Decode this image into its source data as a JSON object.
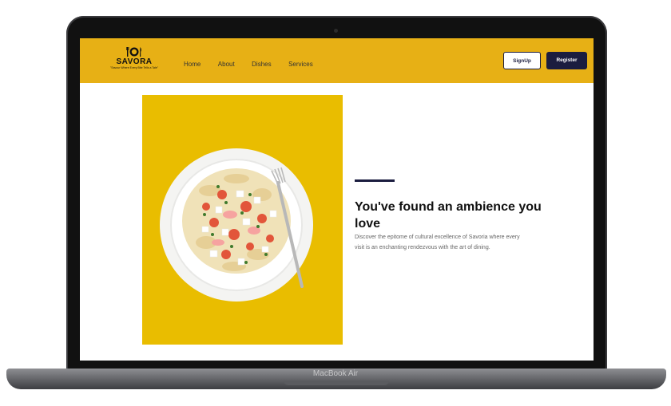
{
  "brand": {
    "name": "SAVORA",
    "tagline": "\"Savour Where Every Bite Tells a Tale\""
  },
  "nav": {
    "links": [
      "Home",
      "About",
      "Dishes",
      "Services"
    ],
    "signup_label": "SignUp",
    "register_label": "Register"
  },
  "hero": {
    "title": "You've found an ambience you love",
    "text": "Discover the epitome of cultural excellence of Savoria where every visit is an enchanting rendezvous with the art of dining."
  },
  "device": {
    "label": "MacBook Air"
  },
  "colors": {
    "navbar": "#e7b015",
    "accent_dark": "#1b1d3f",
    "image_background": "#e9bd00"
  }
}
